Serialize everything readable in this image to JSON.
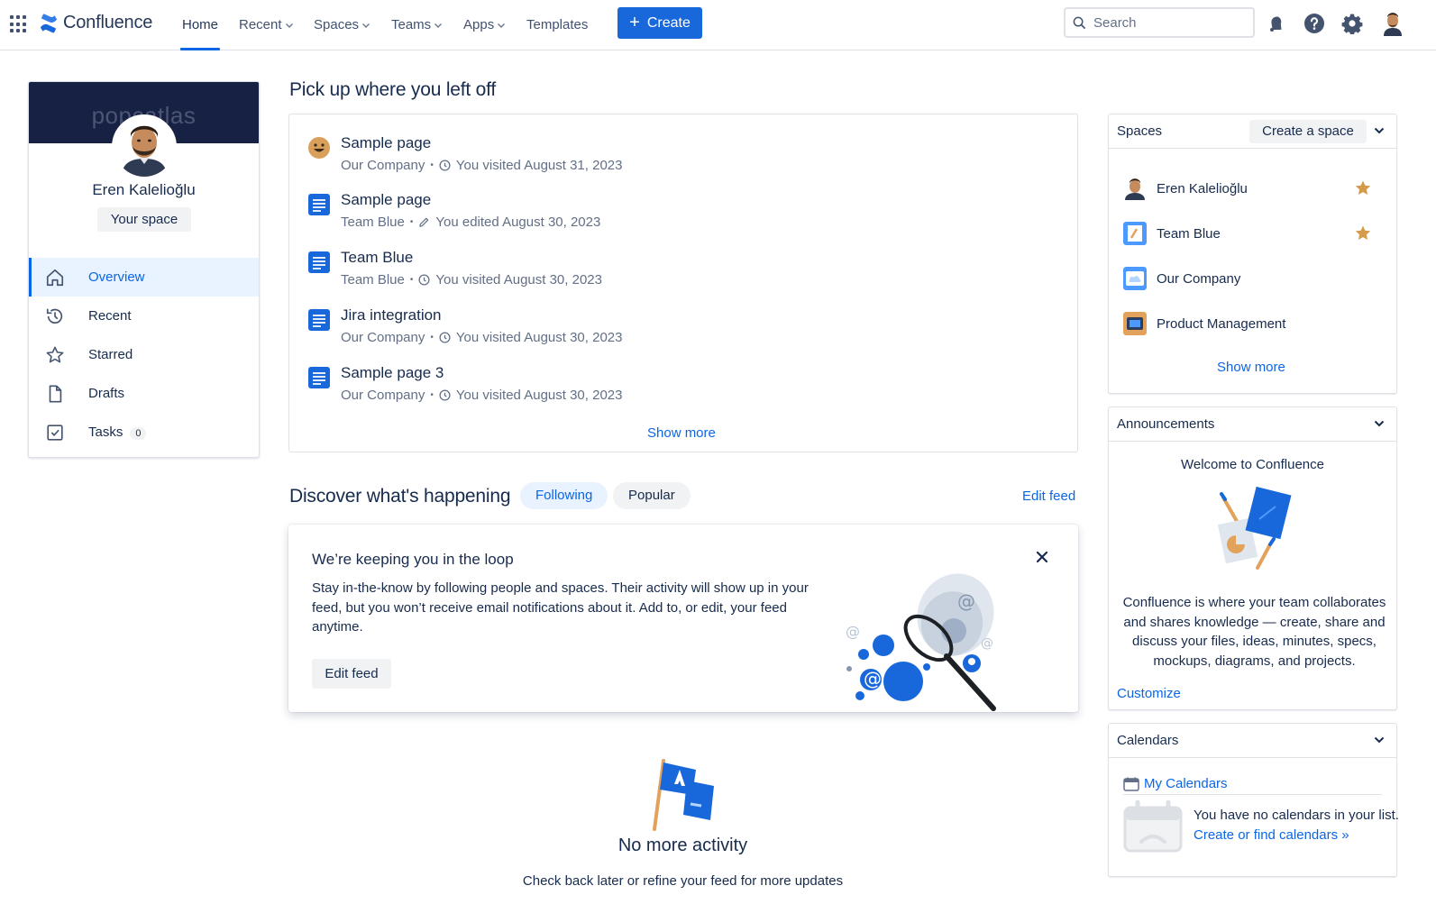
{
  "nav": {
    "logo": "Confluence",
    "items": [
      {
        "label": "Home",
        "active": true
      },
      {
        "label": "Recent",
        "dropdown": true
      },
      {
        "label": "Spaces",
        "dropdown": true
      },
      {
        "label": "Teams",
        "dropdown": true
      },
      {
        "label": "Apps",
        "dropdown": true
      },
      {
        "label": "Templates"
      }
    ],
    "create_label": "Create",
    "search_placeholder": "Search",
    "icons": [
      "notifications-icon",
      "help-icon",
      "settings-icon",
      "profile-avatar"
    ],
    "accent": "#1868db"
  },
  "profile": {
    "banner_text": "popcatlas",
    "name": "Eren Kalelioğlu",
    "your_space": "Your space",
    "menu": [
      {
        "label": "Overview",
        "icon": "home-icon",
        "active": true
      },
      {
        "label": "Recent",
        "icon": "history-icon"
      },
      {
        "label": "Starred",
        "icon": "star-icon"
      },
      {
        "label": "Drafts",
        "icon": "draft-icon"
      },
      {
        "label": "Tasks",
        "icon": "task-icon",
        "count": "0"
      }
    ]
  },
  "recent": {
    "heading": "Pick up where you left off",
    "items": [
      {
        "title": "Sample page",
        "space": "Our Company",
        "action_icon": "clock-icon",
        "action": "You visited August 31, 2023",
        "icon": "emoji-icon"
      },
      {
        "title": "Sample page",
        "space": "Team Blue",
        "action_icon": "pencil-icon",
        "action": "You edited August 30, 2023",
        "icon": "page-icon"
      },
      {
        "title": "Team Blue",
        "space": "Team Blue",
        "action_icon": "clock-icon",
        "action": "You visited August 30, 2023",
        "icon": "page-icon"
      },
      {
        "title": "Jira integration",
        "space": "Our Company",
        "action_icon": "clock-icon",
        "action": "You visited August 30, 2023",
        "icon": "page-icon"
      },
      {
        "title": "Sample page 3",
        "space": "Our Company",
        "action_icon": "clock-icon",
        "action": "You visited August 30, 2023",
        "icon": "page-icon"
      }
    ],
    "show_more": "Show more"
  },
  "discover": {
    "heading": "Discover what's happening",
    "tabs": [
      "Following",
      "Popular"
    ],
    "active_tab": "Following",
    "edit_feed": "Edit feed",
    "loop": {
      "title": "We’re keeping you in the loop",
      "text": "Stay in-the-know by following people and spaces. Their activity will show up in your feed, but you won’t receive email notifications about it. Add to, or edit, your feed anytime.",
      "button": "Edit feed"
    },
    "no_more_title": "No more activity",
    "no_more_sub": "Check back later or refine your feed for more updates"
  },
  "spaces": {
    "title": "Spaces",
    "create_label": "Create a space",
    "items": [
      {
        "name": "Eren Kalelioğlu",
        "starred": true
      },
      {
        "name": "Team Blue",
        "starred": true
      },
      {
        "name": "Our Company",
        "starred": false
      },
      {
        "name": "Product Management",
        "starred": false
      }
    ],
    "show_more": "Show more"
  },
  "announcements": {
    "title": "Announcements",
    "heading": "Welcome to Confluence",
    "text": "Confluence is where your team collaborates and shares knowledge — create, share and discuss your files, ideas, minutes, specs, mockups, diagrams, and projects.",
    "link": "Customize"
  },
  "calendars": {
    "title": "Calendars",
    "link": "My Calendars",
    "empty_text": "You have no calendars in your list.",
    "create_link": "Create or find calendars »"
  }
}
